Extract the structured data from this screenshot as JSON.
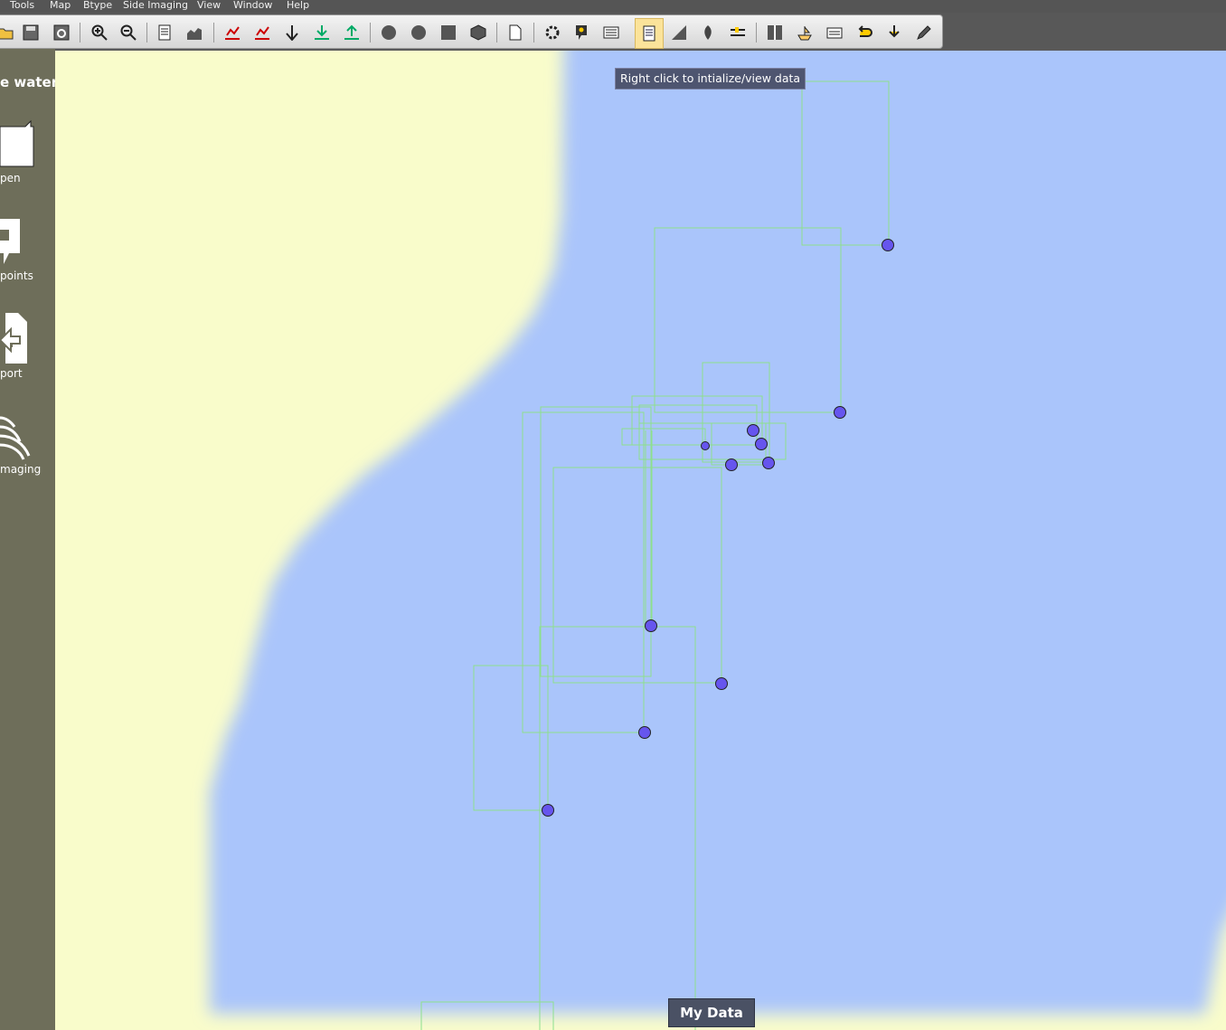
{
  "menu": {
    "items": [
      "Tools",
      "Map",
      "Btype",
      "Side Imaging",
      "View",
      "Window",
      "Help"
    ]
  },
  "toolbar": {
    "buttons": [
      {
        "icon": "open-folder-icon"
      },
      {
        "icon": "save-icon"
      },
      {
        "icon": "save-all-icon"
      },
      {
        "icon": "zoom-in-icon"
      },
      {
        "icon": "zoom-out-icon"
      },
      {
        "icon": "page-icon"
      },
      {
        "icon": "profile-chart-icon"
      },
      {
        "icon": "import-track-icon"
      },
      {
        "icon": "export-track-icon"
      },
      {
        "icon": "depth-icon"
      },
      {
        "icon": "download-icon"
      },
      {
        "icon": "upload-icon"
      },
      {
        "icon": "contour-icon"
      },
      {
        "icon": "contour-2-icon"
      },
      {
        "icon": "fill-icon"
      },
      {
        "icon": "3d-icon"
      },
      {
        "icon": "document-icon"
      },
      {
        "icon": "settings-gear-icon"
      },
      {
        "icon": "waypoint-icon"
      },
      {
        "icon": "layers-icon"
      },
      {
        "icon": "data-panel-icon"
      },
      {
        "icon": "slope-icon"
      },
      {
        "icon": "marker-icon"
      },
      {
        "icon": "ruler-icon"
      },
      {
        "icon": "split-view-icon"
      },
      {
        "icon": "boat-icon"
      },
      {
        "icon": "stack-icon"
      },
      {
        "icon": "undo-icon"
      },
      {
        "icon": "export-icon"
      },
      {
        "icon": "edit-icon"
      }
    ]
  },
  "sidebar": {
    "title": "e water",
    "buttons": [
      {
        "label": "pen",
        "icon": "folder-open-icon"
      },
      {
        "label": "points",
        "icon": "waypoints-icon"
      },
      {
        "label": "port",
        "icon": "import-icon"
      },
      {
        "label": "maging",
        "icon": "side-imaging-icon"
      }
    ]
  },
  "map": {
    "tooltip": "Right click to intialize/view data",
    "data_button": "My Data",
    "colors": {
      "land": "#f9fccb",
      "water": "#aac5fb",
      "track": "#8de08d",
      "point": "#6655ee"
    }
  }
}
